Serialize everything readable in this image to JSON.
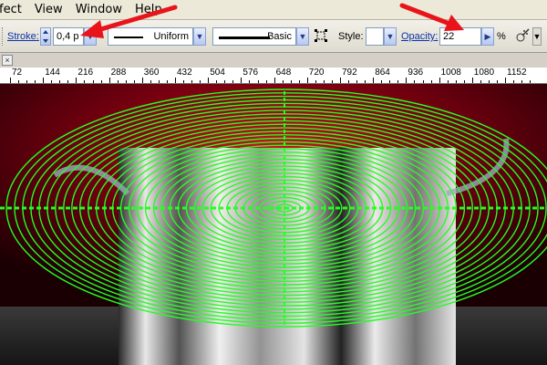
{
  "menu": {
    "items": [
      "fect",
      "View",
      "Window",
      "Help"
    ]
  },
  "control_bar": {
    "stroke_label": "Stroke:",
    "stroke_value": "0,4 p",
    "profile_name": "Uniform",
    "brush_name": "Basic",
    "style_label": "Style:",
    "opacity_label": "Opacity:",
    "opacity_value": "22",
    "percent_sign": "%"
  },
  "document_tab": {
    "close_glyph": "×"
  },
  "ruler": {
    "labels": [
      "72",
      "144",
      "216",
      "288",
      "360",
      "432",
      "504",
      "576",
      "648",
      "720",
      "792",
      "864",
      "936",
      "1008",
      "1080",
      "1152"
    ]
  },
  "colors": {
    "annotation_arrow": "#e8141a",
    "selection_paths": "#22ff22",
    "background_glow": "#8a0010",
    "link_label": "#0b33a8"
  },
  "icons": [
    "stepper-icon",
    "dropdown-arrow-icon",
    "stroke-options-icon",
    "recolor-icon",
    "chevron-right-icon"
  ]
}
